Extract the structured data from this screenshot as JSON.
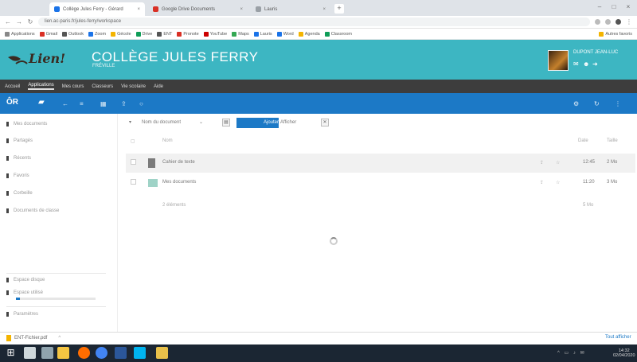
{
  "browser": {
    "tabs": [
      {
        "title": "Collège Jules Ferry - Gérard",
        "color": "#1a73e8"
      },
      {
        "title": "Google Drive Documents",
        "color": "#d93025"
      },
      {
        "title": "Lauris",
        "color": "#9aa0a6"
      }
    ],
    "url": "lien.ac-paris.fr/jules-ferry/workspace",
    "bookmarks": [
      "Applications",
      "Gmail",
      "Outlook",
      "Zoom",
      "Gécole",
      "Drive",
      "ENT",
      "Pronote",
      "YouTube",
      "Maps",
      "Lauris",
      "Word",
      "Agenda",
      "Classroom"
    ],
    "bookmark_colors": [
      "#888",
      "#d93025",
      "#555",
      "#1a73e8",
      "#f4b400",
      "#0f9d58",
      "#555",
      "#d93025",
      "#c00",
      "#34a853",
      "#1a73e8",
      "#1a73e8",
      "#f4b400",
      "#0f9d58"
    ],
    "other_bookmarks": "Autres favoris"
  },
  "header": {
    "logo_text": "Lien!",
    "school_name": "COLLÈGE JULES FERRY",
    "city": "FRÉVILLE",
    "user_name": "DUPONT JEAN-LUC",
    "accent_color": "#3db6c2"
  },
  "nav": {
    "items": [
      "Accueil",
      "Applications",
      "Mes cours",
      "Classeurs",
      "Vie scolaire",
      "Aide"
    ]
  },
  "toolbar": {
    "app_name": "ÔR",
    "icons": [
      "folder-icon",
      "arrow-left-icon",
      "list-icon",
      "grid-icon",
      "share-icon",
      "search-icon"
    ]
  },
  "sidebar": {
    "items": [
      "Mes documents",
      "Partagés",
      "Récents",
      "Favoris",
      "Corbeille",
      "Documents de classe"
    ],
    "bottom_items": [
      "Espace disque",
      "Espace utilisé"
    ],
    "storage_fraction": 0.05,
    "footer_item": "Paramètres"
  },
  "filters": {
    "sort_label": "Nom du document",
    "upload_label": "Ajouter",
    "view_label": "Afficher"
  },
  "table": {
    "headers": {
      "name": "Nom",
      "date": "Date",
      "size": "Taille"
    },
    "rows": [
      {
        "name": "Cahier de texte",
        "date": "12:45",
        "size": "2 Mo",
        "icon_color": "#7b7b7b"
      },
      {
        "name": "Mes documents",
        "date": "11:20",
        "size": "3 Mo",
        "icon_color": "#9fd3c7"
      }
    ],
    "summary": "2 éléments",
    "summary_size": "5 Mo"
  },
  "download_bar": {
    "file": "ENT-Fichier.pdf",
    "show_all": "Tout afficher"
  },
  "taskbar": {
    "clock_time": "14:32",
    "clock_date": "02/04/2020",
    "apps": [
      "start-icon",
      "search-icon",
      "task-view-icon",
      "explorer-icon",
      "firefox-icon",
      "chrome-icon",
      "word-icon",
      "store-icon",
      "folder-icon"
    ],
    "app_colors": [
      "#ffffff",
      "#cfd8dc",
      "#90a4ae",
      "#f4c542",
      "#ff6d00",
      "#4285f4",
      "#2b579a",
      "#00b4f0",
      "#e8c04a"
    ]
  }
}
